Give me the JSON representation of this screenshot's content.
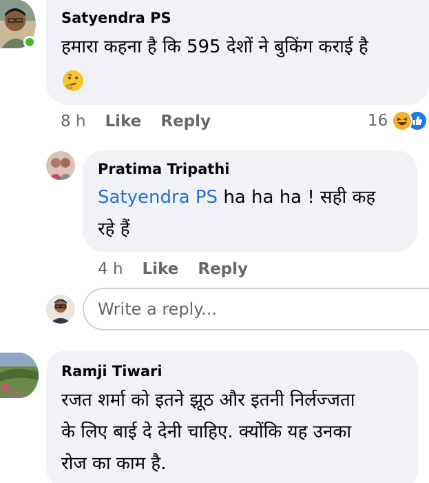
{
  "comments": [
    {
      "author": "Satyendra PS",
      "text_line1": "हमारा कहना है कि 595 देशों ने बुकिंग कराई है",
      "emoji_icon": "thinking-face-icon",
      "time": "8 h",
      "like_label": "Like",
      "reply_label": "Reply",
      "reaction_count": "16",
      "reaction_icons": [
        "haha-reaction-icon",
        "like-reaction-icon"
      ],
      "online": true
    },
    {
      "author": "Pratima Tripathi",
      "mention": "Satyendra PS",
      "text_rest": " ha ha ha !  सही कह",
      "text_line2": "रहे हैं",
      "time": "4 h",
      "like_label": "Like",
      "reply_label": "Reply"
    },
    {
      "author": "Ramji Tiwari",
      "text_line1": "रजत शर्मा को इतने झूठ और इतनी निर्लज्जता",
      "text_line2": "के लिए बाई दे देनी चाहिए. क्योंकि यह उनका",
      "text_line3": "रोज का काम है."
    }
  ],
  "reply_input": {
    "placeholder": "Write a reply..."
  },
  "colors": {
    "bubble": "#f0f2f5",
    "mention": "#216fdb",
    "meta": "#65676b",
    "online": "#42b72a",
    "like": "#1877f2",
    "haha": "#f7b125"
  }
}
